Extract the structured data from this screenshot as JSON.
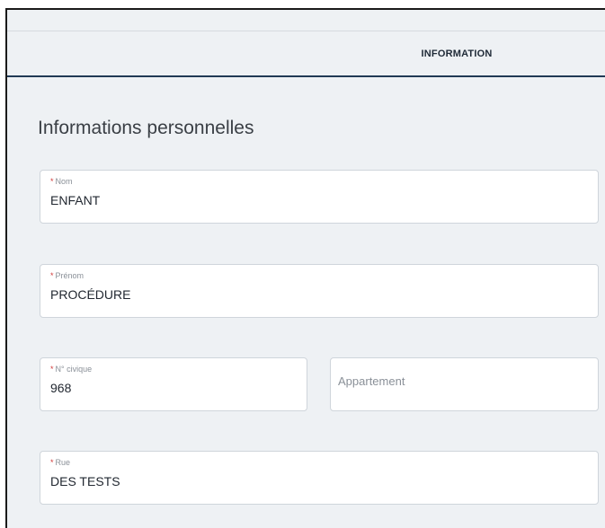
{
  "tabs": {
    "information_label": "INFORMATION"
  },
  "section": {
    "title": "Informations personnelles"
  },
  "fields": {
    "nom": {
      "required_mark": "*",
      "label": "Nom",
      "value": "ENFANT"
    },
    "prenom": {
      "required_mark": "*",
      "label": "Prénom",
      "value": "PROCÉDURE"
    },
    "civique": {
      "required_mark": "*",
      "label": "N° civique",
      "value": "968"
    },
    "appartement": {
      "placeholder": "Appartement",
      "value": ""
    },
    "rue": {
      "required_mark": "*",
      "label": "Rue",
      "value": "DES TESTS"
    }
  },
  "colors": {
    "background": "#eef1f4",
    "tab_underline": "#213a55",
    "required": "#d13a3a"
  }
}
